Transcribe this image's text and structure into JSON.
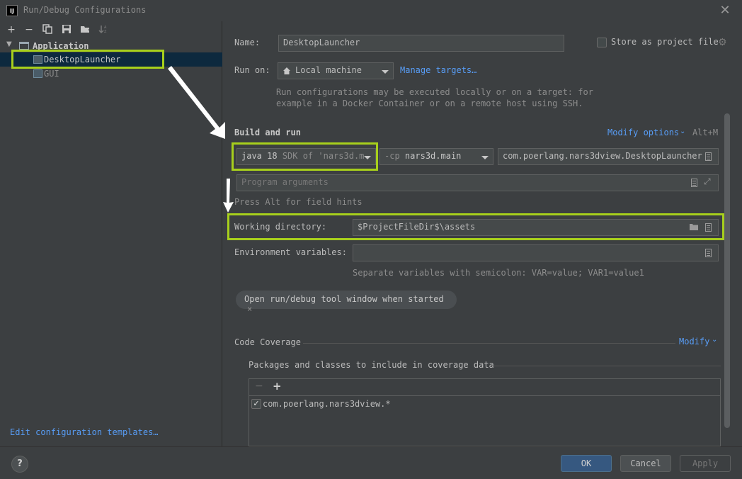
{
  "window": {
    "app_icon_text": "IJ",
    "title": "Run/Debug Configurations",
    "close_glyph": "✕"
  },
  "toolbar": {
    "icons": [
      "add-icon",
      "remove-icon",
      "copy-icon",
      "save-icon",
      "new-folder-icon",
      "sort-icon"
    ],
    "glyphs": [
      "+",
      "−",
      "⧉",
      "💾",
      "▤",
      "↓"
    ]
  },
  "tree": {
    "group_label": "Application",
    "items": [
      {
        "label": "DesktopLauncher",
        "selected": true
      },
      {
        "label": "GUI",
        "selected": false
      }
    ]
  },
  "left_footer": {
    "edit_templates_label": "Edit configuration templates…"
  },
  "form": {
    "name_label": "Name:",
    "name_value": "DesktopLauncher",
    "store_label": "Store as project file",
    "run_on_label": "Run on:",
    "run_on_value": "Local machine",
    "manage_targets_label": "Manage targets…",
    "run_on_hint_line1": "Run configurations may be executed locally or on a target: for",
    "run_on_hint_line2": "example in a Docker Container or on a remote host using SSH.",
    "build_run_title": "Build and run",
    "modify_options_label": "Modify options",
    "modify_options_shortcut": "Alt+M",
    "jdk_version": "java 18",
    "jdk_desc": "SDK of 'nars3d.m",
    "cp_prefix": "-cp",
    "cp_value": "nars3d.main",
    "main_class_value": "com.poerlang.nars3dview.DesktopLauncher",
    "program_args_placeholder": "Program arguments",
    "alt_hint": "Press Alt for field hints",
    "working_dir_label": "Working directory:",
    "working_dir_value": "$ProjectFileDir$\\assets",
    "env_label": "Environment variables:",
    "env_value": "",
    "env_hint": "Separate variables with semicolon: VAR=value; VAR1=value1",
    "tag_chip_label": "Open run/debug tool window when started",
    "tag_chip_close": "×",
    "code_coverage_title": "Code Coverage",
    "coverage_modify_label": "Modify",
    "coverage_packages_label": "Packages and classes to include in coverage data",
    "coverage_remove_glyph": "−",
    "coverage_add_glyph": "+",
    "coverage_items": [
      {
        "label": "com.poerlang.nars3dview.*",
        "checked": true
      }
    ]
  },
  "buttons": {
    "help_label": "?",
    "ok_label": "OK",
    "cancel_label": "Cancel",
    "apply_label": "Apply"
  },
  "colors": {
    "highlight_box": "#a7cf1c",
    "link": "#589df6",
    "selection": "#0d293e",
    "ok_button": "#365880"
  }
}
